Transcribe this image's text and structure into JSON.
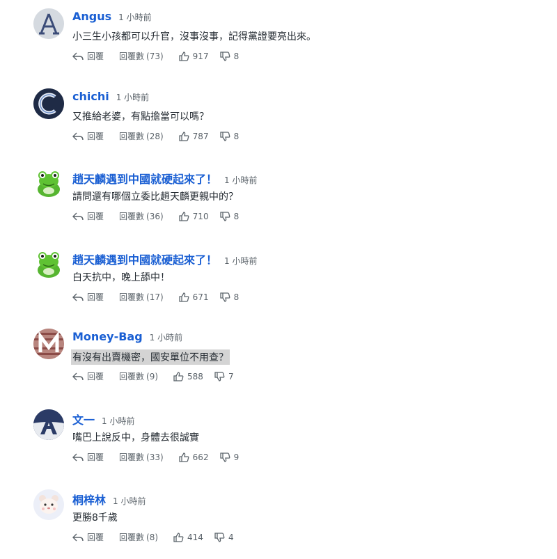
{
  "ui": {
    "reply_label": "回覆",
    "replies_label": "回覆數"
  },
  "comments": [
    {
      "author": "Angus",
      "time": "1 小時前",
      "text": "小三生小孩都可以升官，沒事沒事，記得黨證要亮出來。",
      "replies": "(73)",
      "likes": "917",
      "dislikes": "8",
      "avatar": "letter-a-serif-avatar"
    },
    {
      "author": "chichi",
      "time": "1 小時前",
      "text": "又推給老婆，有點擔當可以嗎？",
      "replies": "(28)",
      "likes": "787",
      "dislikes": "8",
      "avatar": "letter-c-neon-avatar"
    },
    {
      "author": "趙天麟遇到中國就硬起來了！",
      "time": "1 小時前",
      "text": "請問還有哪個立委比趙天麟更親中的？",
      "replies": "(36)",
      "likes": "710",
      "dislikes": "8",
      "avatar": "frog-avatar"
    },
    {
      "author": "趙天麟遇到中國就硬起來了！",
      "time": "1 小時前",
      "text": "白天抗中，晚上舔中！",
      "replies": "(17)",
      "likes": "671",
      "dislikes": "8",
      "avatar": "frog-avatar"
    },
    {
      "author": "Money-Bag",
      "time": "1 小時前",
      "text": "有沒有出賣機密，國安單位不用查？",
      "replies": "(9)",
      "likes": "588",
      "dislikes": "7",
      "avatar": "letter-m-striped-avatar"
    },
    {
      "author": "文一",
      "time": "1 小時前",
      "text": "嘴巴上說反中，身體去很誠實",
      "replies": "(33)",
      "likes": "662",
      "dislikes": "9",
      "avatar": "letter-a-navy-avatar"
    },
    {
      "author": "桐梓林",
      "time": "1 小時前",
      "text": "更勝8千歲",
      "replies": "(8)",
      "likes": "414",
      "dislikes": "4",
      "avatar": "cartoon-bear-avatar"
    }
  ]
}
